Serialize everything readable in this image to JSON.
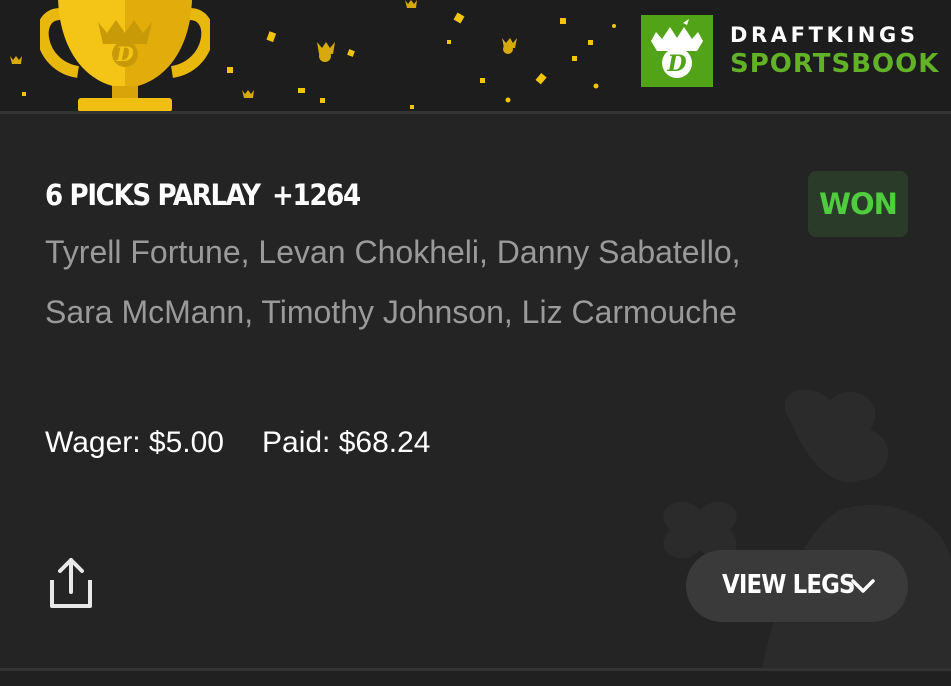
{
  "header": {
    "brand_line1": "DRAFTKINGS",
    "brand_line2": "SPORTSBOOK",
    "trophy_icon": "trophy-icon",
    "brand_icon": "draftkings-crown-logo-icon"
  },
  "bet": {
    "title": "6 PICKS PARLAY",
    "odds": "+1264",
    "status": "WON",
    "picks": "Tyrell Fortune, Levan Chokheli, Danny Sabatello, Sara McMann, Timothy Johnson, Liz Carmouche",
    "wager": "Wager: $5.00",
    "paid": "Paid: $68.24"
  },
  "actions": {
    "view_legs_label": "VIEW LEGS",
    "share_icon": "share-icon",
    "chevron_icon": "chevron-down-icon"
  },
  "colors": {
    "background": "#242424",
    "header_background": "#1d1d1d",
    "brand_green": "#53a318",
    "won_green": "#4fcd3e",
    "won_badge_bg": "#2b3b29",
    "gold": "#f2c40c",
    "muted_text": "#9a9a9a"
  }
}
